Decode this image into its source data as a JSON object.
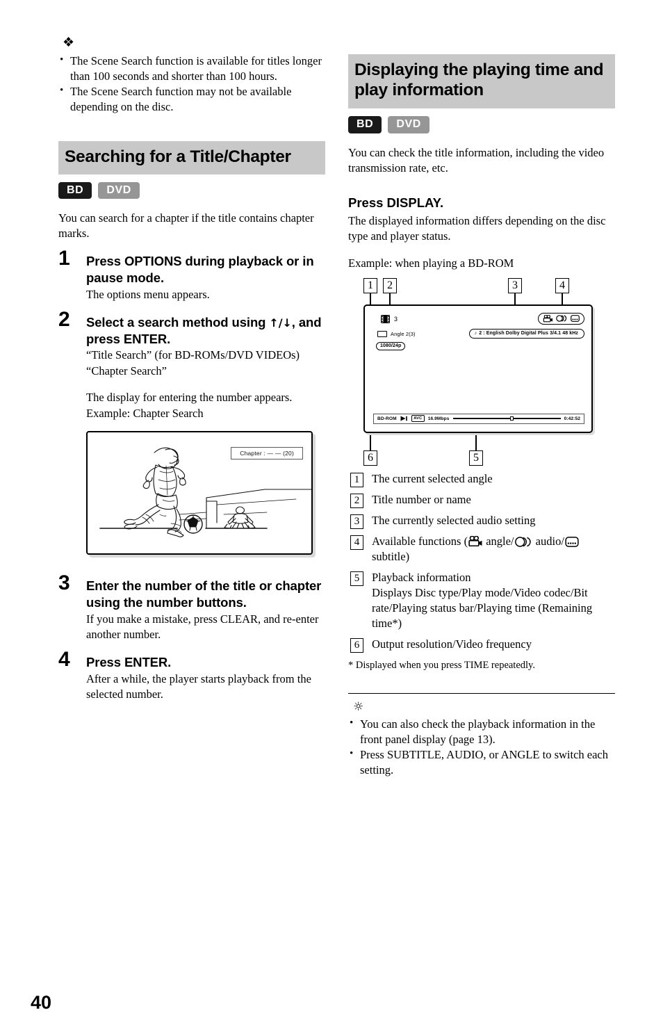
{
  "page_number": "40",
  "left_column": {
    "note_symbol": "note-icon",
    "note_bullets": [
      "The Scene Search function is available for titles longer than 100 seconds and shorter than 100 hours.",
      "The Scene Search function may not be available depending on the disc."
    ],
    "section_title": "Searching for a Title/Chapter",
    "badges": [
      {
        "label": "BD",
        "color": "#1a1a1a"
      },
      {
        "label": "DVD",
        "color": "#969696"
      }
    ],
    "intro": "You can search for a chapter if the title contains chapter marks.",
    "steps": [
      {
        "num": "1",
        "head": "Press OPTIONS during playback or in pause mode.",
        "sub": "The options menu appears."
      },
      {
        "num": "2",
        "head_pre": "Select a search method using ",
        "head_arrows": "↑/↓",
        "head_post": ", and press ENTER.",
        "sub": "“Title Search” (for BD-ROMs/DVD VIDEOs)\n“Chapter Search”",
        "sub_line1": "“Title Search” (for BD-ROMs/DVD VIDEOs)",
        "sub_line2": "“Chapter Search”",
        "sub2_line1": "The display for entering the number appears.",
        "sub2_line2": "Example: Chapter Search"
      },
      {
        "num": "3",
        "head": "Enter the number of the title or chapter using the number buttons.",
        "sub": "If you make a mistake, press CLEAR, and re-enter another number."
      },
      {
        "num": "4",
        "head": "Press ENTER.",
        "sub": "After a while, the player starts playback from the selected number."
      }
    ],
    "illustration": {
      "name": "soccer-player-kicking-ball-illustration",
      "overlay_label": "Chapter :  — —  (20)"
    }
  },
  "right_column": {
    "section_title": "Displaying the playing time and play information",
    "badges": [
      {
        "label": "BD",
        "color": "#1a1a1a"
      },
      {
        "label": "DVD",
        "color": "#969696"
      }
    ],
    "intro": "You can check the title information, including the video transmission rate, etc.",
    "lead": "Press DISPLAY.",
    "lead_sub": "The displayed information differs depending on the disc type and player status.",
    "example_caption": "Example: when playing a BD-ROM",
    "osd": {
      "callouts": [
        "1",
        "2",
        "3",
        "4",
        "5",
        "6"
      ],
      "title_number": "3",
      "angle_label": "Angle  2(3)",
      "resolution": "1080/24p",
      "audio_info": "2 : English  Dolby Digital Plus  3/4.1 48 kHz",
      "audio_note_glyph": "♪",
      "function_icons": [
        "angle-icon",
        "audio-icon",
        "subtitle-icon"
      ],
      "playback": {
        "disc_type": "BD-ROM",
        "play_mode": "play-icon",
        "video_codec": "AVC",
        "bit_rate": "16.9Mbps",
        "playing_time": "0:42:52",
        "progress_percent": 53
      }
    },
    "legend": [
      {
        "num": "1",
        "text": "The current selected angle"
      },
      {
        "num": "2",
        "text": "Title number or name"
      },
      {
        "num": "3",
        "text": "The currently selected audio setting"
      },
      {
        "num": "4",
        "text_pre": "Available functions (",
        "text_mid1": " angle/",
        "text_mid2": " audio/",
        "text_post": " subtitle)"
      },
      {
        "num": "5",
        "text": "Playback information",
        "sub": "Displays Disc type/Play mode/Video codec/Bit rate/Playing status bar/Playing time (Remaining time*)"
      },
      {
        "num": "6",
        "text": "Output resolution/Video frequency"
      }
    ],
    "footnote": "* Displayed when you press TIME repeatedly.",
    "tip_symbol": "tip-bulb-icon",
    "tip_bullets": [
      "You can also check the playback information in the front panel display (page 13).",
      "Press SUBTITLE, AUDIO, or ANGLE to switch each setting."
    ]
  }
}
